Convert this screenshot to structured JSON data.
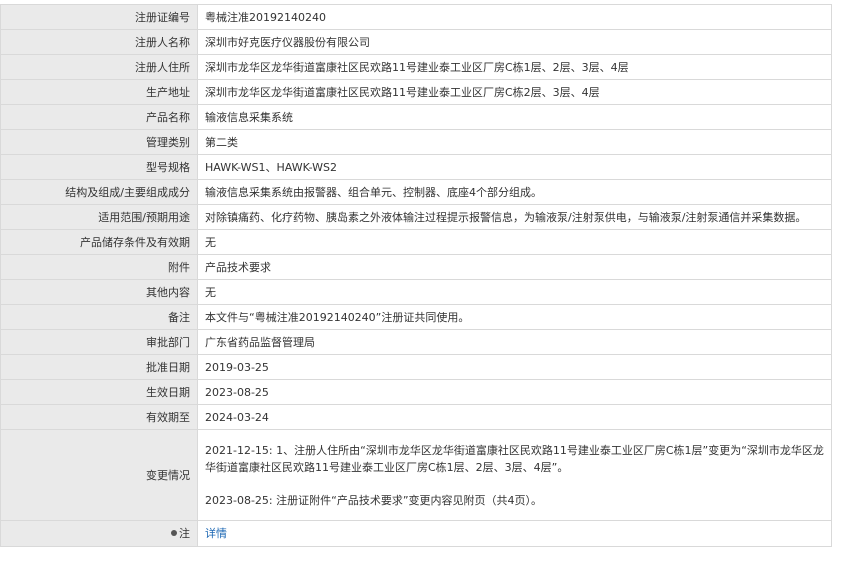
{
  "rows": [
    {
      "label": "注册证编号",
      "value": "粤械注准20192140240"
    },
    {
      "label": "注册人名称",
      "value": "深圳市好克医疗仪器股份有限公司"
    },
    {
      "label": "注册人住所",
      "value": "深圳市龙华区龙华街道富康社区民欢路11号建业泰工业区厂房C栋1层、2层、3层、4层"
    },
    {
      "label": "生产地址",
      "value": "深圳市龙华区龙华街道富康社区民欢路11号建业泰工业区厂房C栋2层、3层、4层"
    },
    {
      "label": "产品名称",
      "value": "输液信息采集系统"
    },
    {
      "label": "管理类别",
      "value": "第二类"
    },
    {
      "label": "型号规格",
      "value": "HAWK-WS1、HAWK-WS2"
    },
    {
      "label": "结构及组成/主要组成成分",
      "value": "输液信息采集系统由报警器、组合单元、控制器、底座4个部分组成。"
    },
    {
      "label": "适用范围/预期用途",
      "value": "对除镇痛药、化疗药物、胰岛素之外液体输注过程提示报警信息，为输液泵/注射泵供电，与输液泵/注射泵通信并采集数据。"
    },
    {
      "label": "产品储存条件及有效期",
      "value": "无"
    },
    {
      "label": "附件",
      "value": "产品技术要求"
    },
    {
      "label": "其他内容",
      "value": "无"
    },
    {
      "label": "备注",
      "value": "本文件与“粤械注准20192140240”注册证共同使用。"
    },
    {
      "label": "审批部门",
      "value": "广东省药品监督管理局"
    },
    {
      "label": "批准日期",
      "value": "2019-03-25"
    },
    {
      "label": "生效日期",
      "value": "2023-08-25"
    },
    {
      "label": "有效期至",
      "value": "2024-03-24"
    }
  ],
  "changes": {
    "label": "变更情况",
    "entries": [
      "2021-12-15: 1、注册人住所由“深圳市龙华区龙华街道富康社区民欢路11号建业泰工业区厂房C栋1层”变更为“深圳市龙华区龙华街道富康社区民欢路11号建业泰工业区厂房C栋1层、2层、3层、4层”。",
      "2023-08-25: 注册证附件“产品技术要求”变更内容见附页（共4页）。"
    ]
  },
  "note": {
    "label": "注",
    "icon": "pin-icon",
    "link_text": "详情",
    "link_color": "#1a66b3"
  }
}
